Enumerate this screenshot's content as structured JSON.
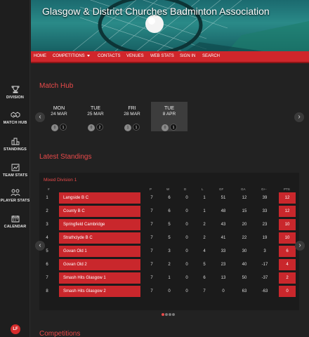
{
  "banner": {
    "title": "Glasgow & District Churches Badminton Association"
  },
  "nav": {
    "items": [
      "HOME",
      "COMPETITIONS",
      "CONTACTS",
      "VENUES",
      "WEB STATS",
      "SIGN IN",
      "SEARCH"
    ]
  },
  "sidebar": {
    "items": [
      {
        "label": "DIVISION",
        "icon": "trophy-icon"
      },
      {
        "label": "MATCH HUB",
        "icon": "handshake-icon"
      },
      {
        "label": "STANDINGS",
        "icon": "standings-icon"
      },
      {
        "label": "TEAM STATS",
        "icon": "team-stats-icon"
      },
      {
        "label": "PLAYER STATS",
        "icon": "player-stats-icon"
      },
      {
        "label": "CALENDAR",
        "icon": "calendar-icon"
      }
    ],
    "logo_text": "LF"
  },
  "match_hub": {
    "title": "Match Hub",
    "cards": [
      {
        "day": "MON",
        "date": "24 MAR",
        "a": "0",
        "b": "1"
      },
      {
        "day": "TUE",
        "date": "25 MAR",
        "a": "0",
        "b": "2"
      },
      {
        "day": "FRI",
        "date": "28 MAR",
        "a": "1",
        "b": "1"
      },
      {
        "day": "TUE",
        "date": "8 APR",
        "a": "0",
        "b": "1"
      }
    ],
    "prev_glyph": "‹",
    "next_glyph": "›"
  },
  "standings": {
    "title": "Latest Standings",
    "division": "Mixed Division 1",
    "headers": {
      "pos": "#",
      "p": "P",
      "w": "W",
      "d": "D",
      "l": "L",
      "gf": "GF",
      "ga": "GA",
      "gd": "G+-",
      "pts": "PTS"
    },
    "rows": [
      {
        "pos": "1",
        "team": "Langside B C",
        "p": "7",
        "w": "6",
        "d": "0",
        "l": "1",
        "gf": "51",
        "ga": "12",
        "gd": "39",
        "pts": "12"
      },
      {
        "pos": "2",
        "team": "County B C",
        "p": "7",
        "w": "6",
        "d": "0",
        "l": "1",
        "gf": "48",
        "ga": "15",
        "gd": "33",
        "pts": "12"
      },
      {
        "pos": "3",
        "team": "Springfield Cambridge",
        "p": "7",
        "w": "5",
        "d": "0",
        "l": "2",
        "gf": "43",
        "ga": "20",
        "gd": "23",
        "pts": "10"
      },
      {
        "pos": "4",
        "team": "Strathclyde B C",
        "p": "7",
        "w": "5",
        "d": "0",
        "l": "2",
        "gf": "41",
        "ga": "22",
        "gd": "19",
        "pts": "10"
      },
      {
        "pos": "5",
        "team": "Govan Old 1",
        "p": "7",
        "w": "3",
        "d": "0",
        "l": "4",
        "gf": "33",
        "ga": "30",
        "gd": "3",
        "pts": "6"
      },
      {
        "pos": "6",
        "team": "Govan Old 2",
        "p": "7",
        "w": "2",
        "d": "0",
        "l": "5",
        "gf": "23",
        "ga": "40",
        "gd": "-17",
        "pts": "4"
      },
      {
        "pos": "7",
        "team": "Smash Hits Glasgow 1",
        "p": "7",
        "w": "1",
        "d": "0",
        "l": "6",
        "gf": "13",
        "ga": "50",
        "gd": "-37",
        "pts": "2"
      },
      {
        "pos": "8",
        "team": "Smash Hits Glasgow 2",
        "p": "7",
        "w": "0",
        "d": "0",
        "l": "7",
        "gf": "0",
        "ga": "63",
        "gd": "-63",
        "pts": "0"
      }
    ],
    "prev_glyph": "‹",
    "next_glyph": "›",
    "page_count": 4,
    "current_page": 1
  },
  "competitions": {
    "title": "Competitions"
  },
  "colors": {
    "accent": "#d0262b",
    "heading": "#e94a4a",
    "background": "#222222"
  }
}
